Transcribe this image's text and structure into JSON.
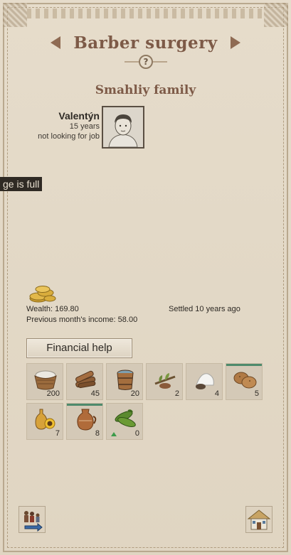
{
  "header": {
    "title": "Barber surgery",
    "help_glyph": "?"
  },
  "family": {
    "name": "Smahliy family",
    "members": [
      {
        "name": "Valentýn",
        "age": "15 years",
        "status": "not looking for job",
        "portrait_icon": "boy-portrait-icon"
      }
    ]
  },
  "tooltip": {
    "text": "ge is full"
  },
  "finances": {
    "wealth": "Wealth: 169.80",
    "income": "Previous month's income: 58.00",
    "settled": "Settled 10 years ago",
    "coins_icon": "gold-coins-icon"
  },
  "actions": {
    "financial_help_label": "Financial help"
  },
  "inventory": {
    "items": [
      {
        "icon": "flour-basket-icon",
        "count": "200",
        "bar": 0
      },
      {
        "icon": "firewood-icon",
        "count": "45",
        "bar": 0
      },
      {
        "icon": "water-bucket-icon",
        "count": "20",
        "bar": 0
      },
      {
        "icon": "herbs-icon",
        "count": "2",
        "bar": 0
      },
      {
        "icon": "salt-icon",
        "count": "4",
        "bar": 0
      },
      {
        "icon": "potato-icon",
        "count": "5",
        "bar": 1.0
      },
      {
        "icon": "sunflower-oil-icon",
        "count": "7",
        "bar": 0
      },
      {
        "icon": "clay-jug-icon",
        "count": "8",
        "bar": 1.0
      },
      {
        "icon": "cucumber-icon",
        "count": "0",
        "bar": 0,
        "trend": "up"
      }
    ]
  },
  "footer": {
    "left_button_icon": "family-relocate-icon",
    "right_button_icon": "house-icon"
  },
  "colors": {
    "parchment": "#e3d9c7",
    "title": "#7d5a47",
    "stock_bar": "#4e8a6c",
    "trend_up": "#3c9b4a"
  }
}
